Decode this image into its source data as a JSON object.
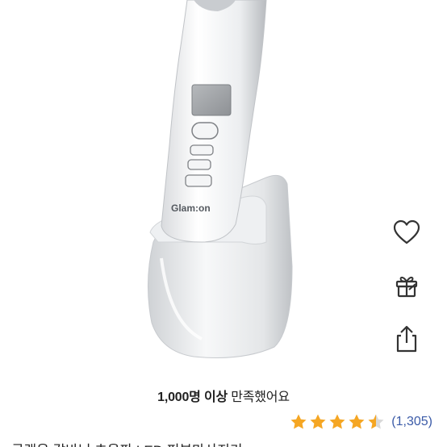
{
  "product": {
    "brand_logo": "Glam:on",
    "title": "글램온 갈바닉 초음파 LED 피부마사지기"
  },
  "actions": {
    "wishlist_icon": "heart-icon",
    "gift_icon": "gift-icon",
    "share_icon": "share-icon"
  },
  "satisfaction": {
    "count_text": "1,000명 이상",
    "suffix_text": " 만족했어요"
  },
  "rating": {
    "stars": 4.5,
    "max_stars": 5,
    "review_count": "(1,305)"
  },
  "colors": {
    "star": "#f5a623",
    "star_empty": "#d9d9d9",
    "review_link": "#3b5ba8"
  }
}
